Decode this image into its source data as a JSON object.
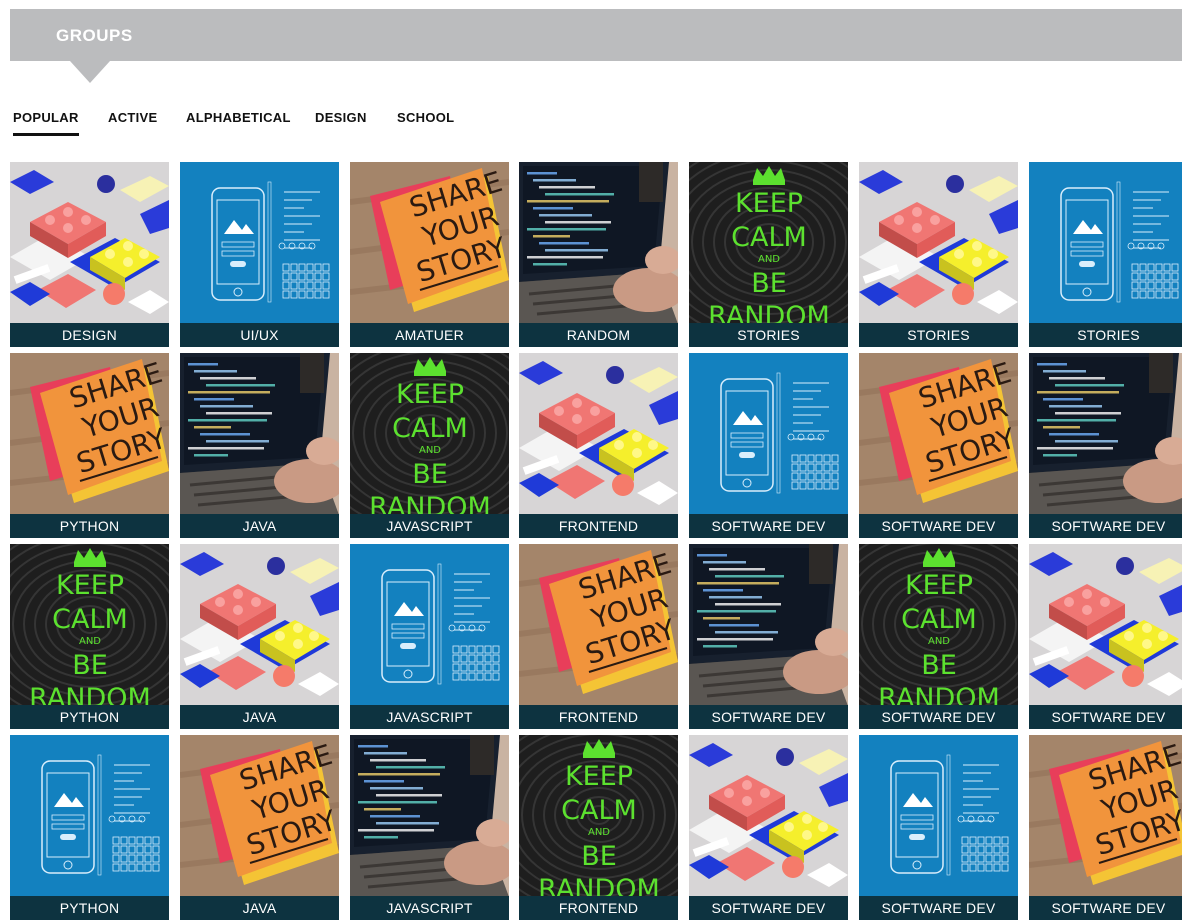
{
  "header": {
    "title": "GROUPS"
  },
  "tabs": [
    {
      "label": "POPULAR",
      "active": true
    },
    {
      "label": "ACTIVE",
      "active": false
    },
    {
      "label": "ALPHABETICAL",
      "active": false
    },
    {
      "label": "DESIGN",
      "active": false
    },
    {
      "label": "SCHOOL",
      "active": false
    }
  ],
  "groups": [
    [
      {
        "label": "DESIGN",
        "art": "isometric-blocks"
      },
      {
        "label": "UI/UX",
        "art": "phone-wireframe"
      },
      {
        "label": "AMATUER",
        "art": "sticky-note"
      },
      {
        "label": "RANDOM",
        "art": "laptop-code"
      },
      {
        "label": "STORIES",
        "art": "keep-calm"
      },
      {
        "label": "STORIES",
        "art": "isometric-blocks"
      },
      {
        "label": "STORIES",
        "art": "phone-wireframe"
      }
    ],
    [
      {
        "label": "PYTHON",
        "art": "sticky-note"
      },
      {
        "label": "JAVA",
        "art": "laptop-code"
      },
      {
        "label": "JAVASCRIPT",
        "art": "keep-calm"
      },
      {
        "label": "FRONTEND",
        "art": "isometric-blocks"
      },
      {
        "label": "SOFTWARE DEV",
        "art": "phone-wireframe"
      },
      {
        "label": "SOFTWARE DEV",
        "art": "sticky-note"
      },
      {
        "label": "SOFTWARE DEV",
        "art": "laptop-code"
      }
    ],
    [
      {
        "label": "PYTHON",
        "art": "keep-calm"
      },
      {
        "label": "JAVA",
        "art": "isometric-blocks"
      },
      {
        "label": "JAVASCRIPT",
        "art": "phone-wireframe"
      },
      {
        "label": "FRONTEND",
        "art": "sticky-note"
      },
      {
        "label": "SOFTWARE DEV",
        "art": "laptop-code"
      },
      {
        "label": "SOFTWARE DEV",
        "art": "keep-calm"
      },
      {
        "label": "SOFTWARE DEV",
        "art": "isometric-blocks"
      }
    ],
    [
      {
        "label": "PYTHON",
        "art": "phone-wireframe"
      },
      {
        "label": "JAVA",
        "art": "sticky-note"
      },
      {
        "label": "JAVASCRIPT",
        "art": "laptop-code"
      },
      {
        "label": "FRONTEND",
        "art": "keep-calm"
      },
      {
        "label": "SOFTWARE DEV",
        "art": "isometric-blocks"
      },
      {
        "label": "SOFTWARE DEV",
        "art": "phone-wireframe"
      },
      {
        "label": "SOFTWARE DEV",
        "art": "sticky-note"
      }
    ]
  ],
  "art_text": {
    "sticky_note": [
      "SHARE",
      "YOUR",
      "STORY"
    ],
    "keep_calm": [
      "KEEP",
      "CALM",
      "AND",
      "BE",
      "RANDOM"
    ]
  },
  "colors": {
    "header": "#bbbcbe",
    "label_bar": "#0d3340",
    "phone_bg": "#1381bf",
    "keep_calm_text": "#5ce12f"
  }
}
